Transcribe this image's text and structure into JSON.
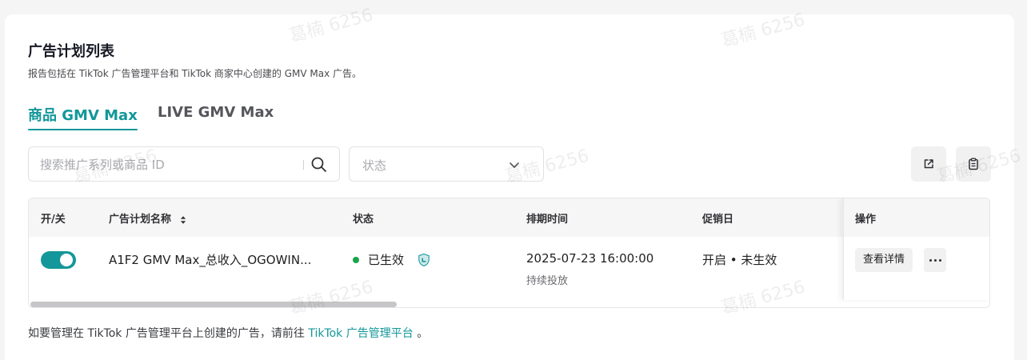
{
  "header": {
    "title": "广告计划列表",
    "subtitle": "报告包括在 TikTok 广告管理平台和 TikTok 商家中心创建的 GMV Max 广告。"
  },
  "tabs": [
    {
      "label": "商品 GMV Max",
      "active": true
    },
    {
      "label": "LIVE GMV Max",
      "active": false
    }
  ],
  "filters": {
    "search_placeholder": "搜索推广系列或商品 ID",
    "status_placeholder": "状态"
  },
  "toolbar": {
    "export_icon": "external-link-icon",
    "clipboard_icon": "clipboard-icon"
  },
  "table": {
    "columns": {
      "toggle": "开/关",
      "name": "广告计划名称",
      "status": "状态",
      "schedule": "排期时间",
      "promo": "促销日",
      "actions": "操作"
    },
    "rows": [
      {
        "enabled": true,
        "name": "A1F2 GMV Max_总收入_OGOWIN...",
        "status": "已生效",
        "status_color": "#1aa34a",
        "schedule_start": "2025-07-23 16:00:00",
        "schedule_sub": "持续投放",
        "promo": "开启 • 未生效",
        "detail_label": "查看详情"
      }
    ]
  },
  "footer": {
    "text_before": "如要管理在 TikTok 广告管理平台上创建的广告，请前往",
    "link": "TikTok 广告管理平台",
    "text_after": "。"
  },
  "watermark": "葛楠 6256",
  "colors": {
    "accent": "#13979a",
    "active_status": "#1aa34a"
  }
}
